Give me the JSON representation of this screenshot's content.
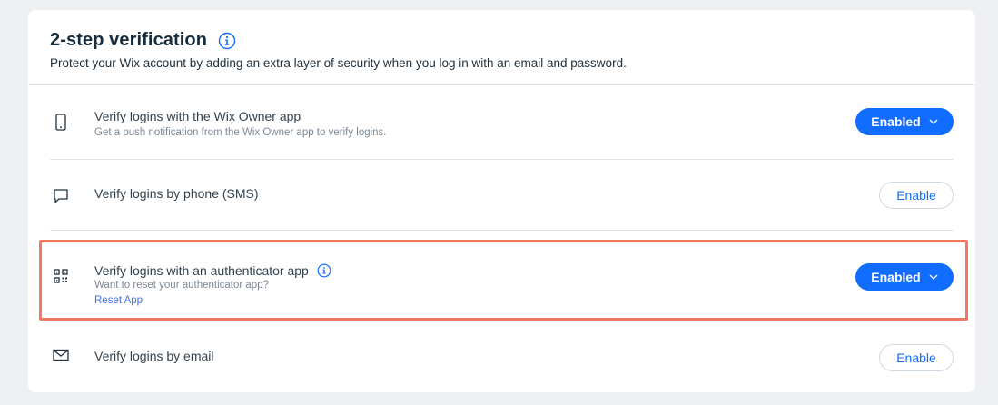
{
  "header": {
    "title": "2-step verification",
    "subtitle": "Protect your Wix account by adding an extra layer of security when you log in with an email and password."
  },
  "colors": {
    "accent": "#116dff",
    "highlight": "#f07a61",
    "link": "#3d6ff5"
  },
  "methods": [
    {
      "icon": "mobile-phone-icon",
      "title": "Verify logins with the Wix Owner app",
      "subtitle": "Get a push notification from the Wix Owner app to verify logins.",
      "button": "Enabled"
    },
    {
      "icon": "chat-bubble-icon",
      "title": "Verify logins by phone (SMS)",
      "button": "Enable"
    },
    {
      "icon": "qr-code-icon",
      "title": "Verify logins with an authenticator app",
      "subtitle": "Want to reset your authenticator app?",
      "link": "Reset App",
      "button": "Enabled"
    },
    {
      "icon": "envelope-icon",
      "title": "Verify logins by email",
      "button": "Enable"
    }
  ]
}
